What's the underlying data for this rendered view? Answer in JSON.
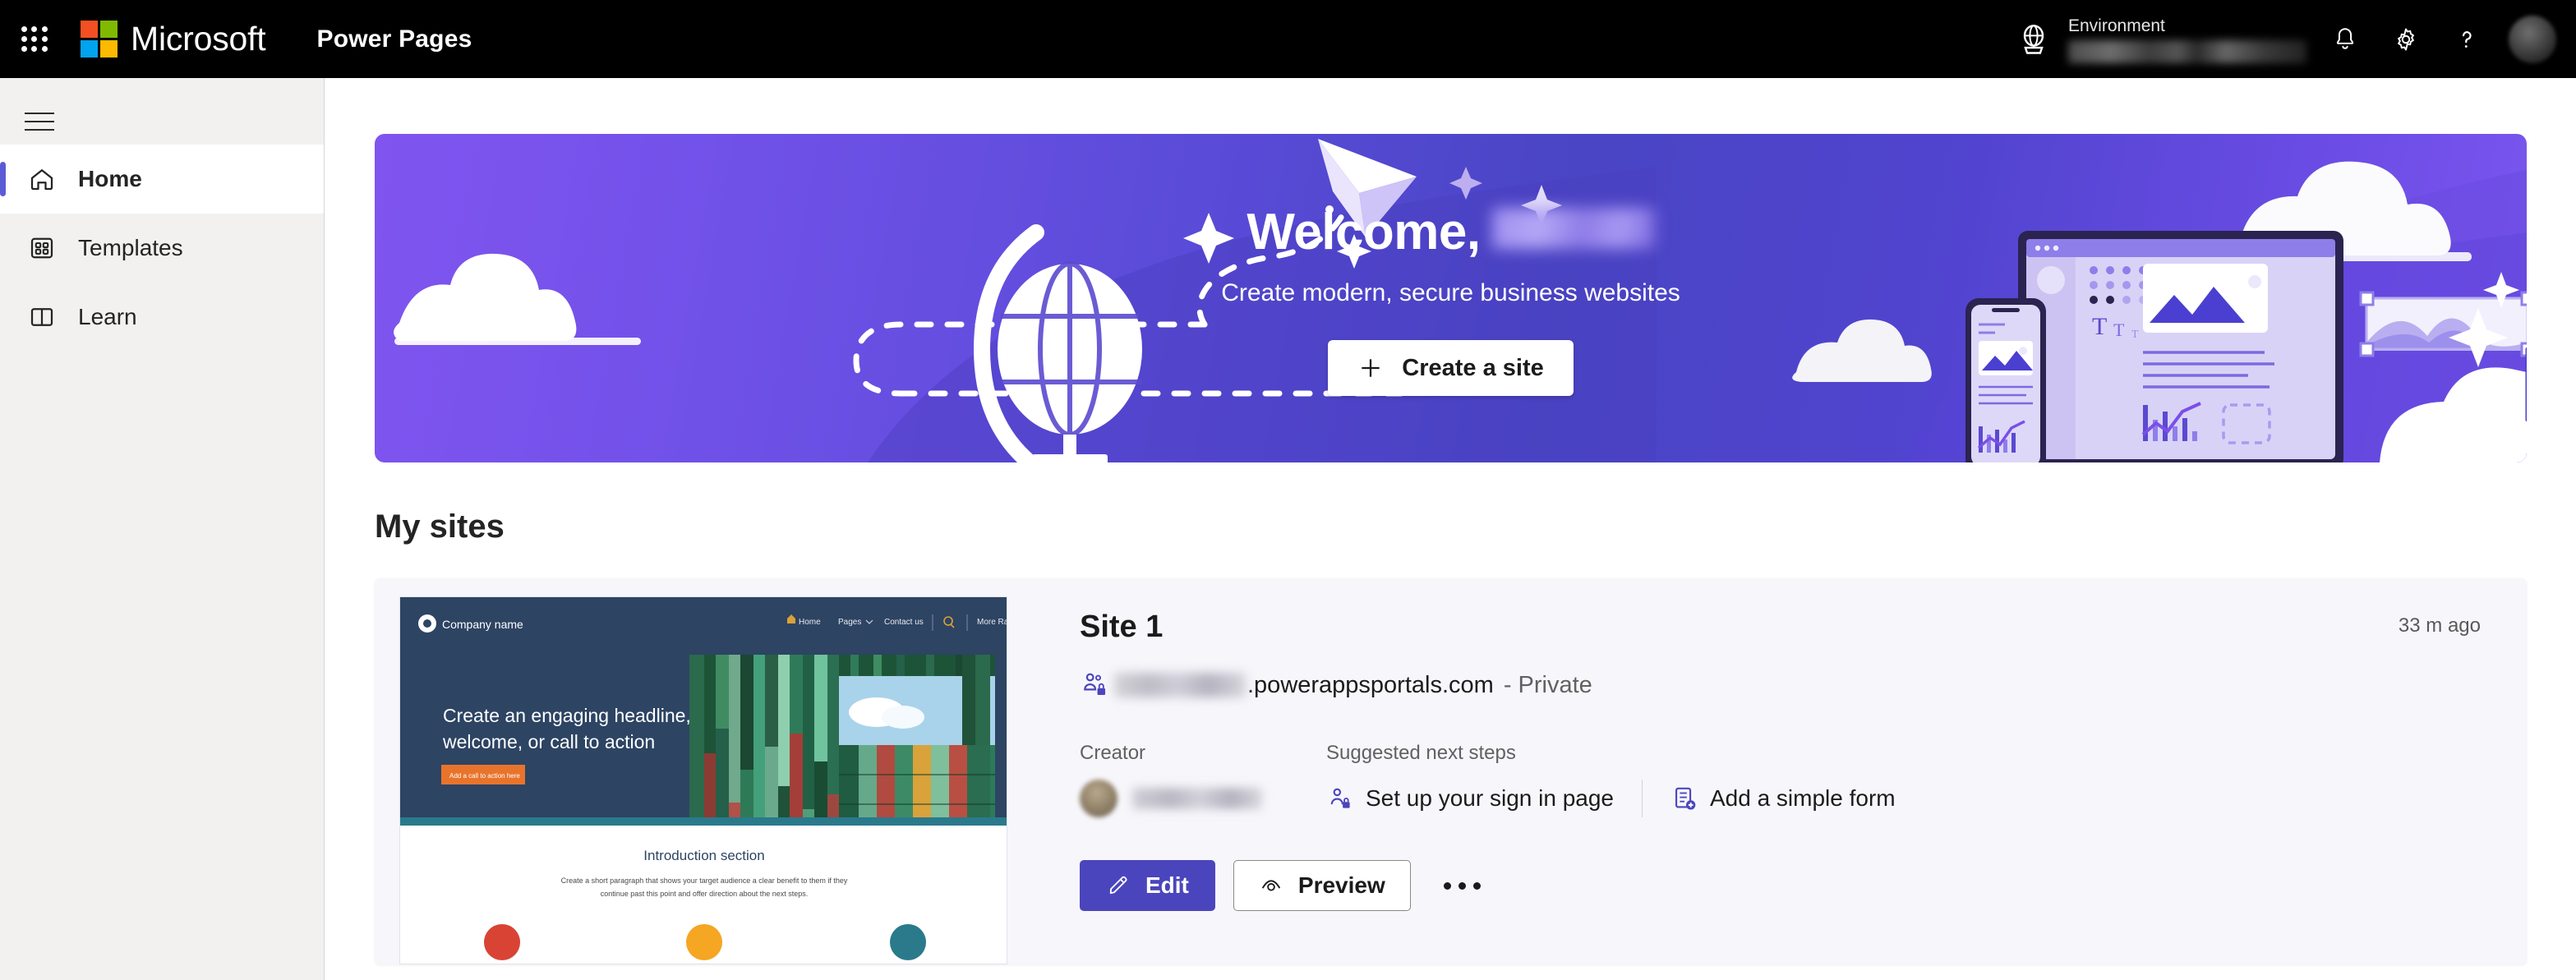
{
  "header": {
    "waffle_label": "app-launcher",
    "brand": "Microsoft",
    "app_title": "Power Pages",
    "environment_label": "Environment",
    "environment_value_redacted": true,
    "icons": [
      "environment-globe-icon",
      "notifications-bell-icon",
      "settings-gear-icon",
      "help-question-icon",
      "user-avatar"
    ]
  },
  "sidebar": {
    "menu_toggle": "hamburger-menu",
    "items": [
      {
        "label": "Home",
        "icon": "home-icon",
        "active": true
      },
      {
        "label": "Templates",
        "icon": "templates-icon",
        "active": false
      },
      {
        "label": "Learn",
        "icon": "learn-book-icon",
        "active": false
      }
    ]
  },
  "hero": {
    "greeting": "Welcome,",
    "name_redacted": true,
    "subtitle": "Create modern, secure business websites",
    "create_button": "Create a site",
    "create_icon": "plus-icon",
    "colors": {
      "gradient_left": "#8054ef",
      "gradient_center": "#4945c4",
      "gradient_right": "#7b56ef"
    }
  },
  "main": {
    "section_title": "My sites"
  },
  "site_card": {
    "title": "Site 1",
    "time_ago": "33 m ago",
    "url_icon": "people-lock-icon",
    "url_prefix_redacted": true,
    "url_domain": ".powerappsportals.com",
    "visibility": "- Private",
    "creator_label": "Creator",
    "creator_name_redacted": true,
    "steps_label": "Suggested next steps",
    "steps": [
      {
        "label": "Set up your sign in page",
        "icon": "person-lock-icon"
      },
      {
        "label": "Add a simple form",
        "icon": "form-add-icon"
      }
    ],
    "actions": {
      "edit": "Edit",
      "edit_icon": "pencil-icon",
      "preview": "Preview",
      "preview_icon": "eye-icon",
      "more": "more-options-icon"
    },
    "accent_color": "#4b45bd"
  },
  "thumbnail": {
    "company_name": "Company name",
    "nav": [
      "Home",
      "Pages",
      "Contact us",
      "More Rates"
    ],
    "search_icon": "search-icon",
    "headline": "Create an engaging headline, welcome, or call to action",
    "cta": "Add a call to action here",
    "intro_title": "Introduction section",
    "intro_body": "Create a short paragraph that shows your target audience a clear benefit to them if they continue past this point and offer direction about the next steps.",
    "bg_color": "#2d4463",
    "cta_color": "#e8742c",
    "dots": [
      "#d94334",
      "#f5a623",
      "#2a7a8c"
    ]
  }
}
